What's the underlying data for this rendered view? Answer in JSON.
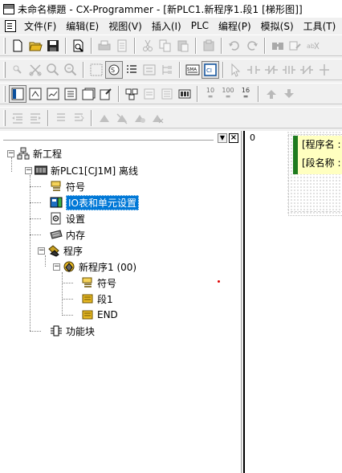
{
  "window": {
    "title": "未命名標題 - CX-Programmer - [新PLC1.新程序1.段1 [梯形图]]"
  },
  "menu": {
    "items": [
      "文件(F)",
      "编辑(E)",
      "视图(V)",
      "插入(I)",
      "PLC",
      "编程(P)",
      "模拟(S)",
      "工具(T)"
    ]
  },
  "toolbar3": {
    "btn_10": "10",
    "btn_100": "100",
    "btn_16": "16"
  },
  "project_tree": {
    "root": "新工程",
    "plc": "新PLC1[CJ1M] 离线",
    "symbols": "符号",
    "io_table": "IO表和单元设置",
    "settings": "设置",
    "memory": "内存",
    "programs": "程序",
    "new_program": "新程序1 (00)",
    "prog_symbols": "符号",
    "section1": "段1",
    "end": "END",
    "function_blocks": "功能块"
  },
  "ladder": {
    "row_number": "0",
    "program_name_label": "[程序名 :",
    "section_name_label": "[段名称 :"
  },
  "colors": {
    "selection": "#0078d7",
    "rung_bar": "#1e7b1e",
    "comment_bg": "#ffffc0"
  }
}
